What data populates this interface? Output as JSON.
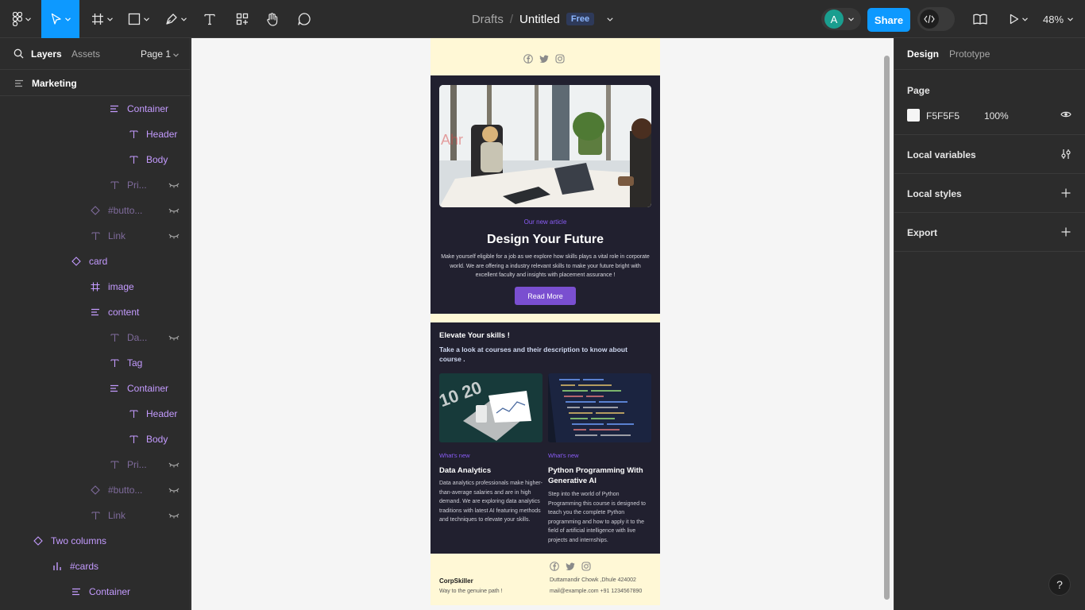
{
  "toolbar": {
    "breadcrumb_folder": "Drafts",
    "breadcrumb_sep": "/",
    "file_title": "Untitled",
    "plan_badge": "Free",
    "avatar_initial": "A",
    "share_label": "Share",
    "zoom": "48%"
  },
  "left_panel": {
    "tab_layers": "Layers",
    "tab_assets": "Assets",
    "page_selector": "Page 1",
    "root_layer": "Marketing",
    "layers": [
      {
        "label": "Container",
        "icon": "autolayout-icon"
      },
      {
        "label": "Header",
        "icon": "text-icon"
      },
      {
        "label": "Body",
        "icon": "text-icon"
      },
      {
        "label": "Pri...",
        "icon": "text-icon"
      },
      {
        "label": "#butto...",
        "icon": "instance-icon"
      },
      {
        "label": "Link",
        "icon": "text-icon"
      },
      {
        "label": "card",
        "icon": "instance-icon"
      },
      {
        "label": "image",
        "icon": "frame-icon"
      },
      {
        "label": "content",
        "icon": "autolayout-icon"
      },
      {
        "label": "Da...",
        "icon": "text-icon"
      },
      {
        "label": "Tag",
        "icon": "text-icon"
      },
      {
        "label": "Container",
        "icon": "autolayout-icon"
      },
      {
        "label": "Header",
        "icon": "text-icon"
      },
      {
        "label": "Body",
        "icon": "text-icon"
      },
      {
        "label": "Pri...",
        "icon": "text-icon"
      },
      {
        "label": "#butto...",
        "icon": "instance-icon"
      },
      {
        "label": "Link",
        "icon": "text-icon"
      },
      {
        "label": "Two columns",
        "icon": "instance-icon"
      },
      {
        "label": "#cards",
        "icon": "bar-chart-icon"
      },
      {
        "label": "Container",
        "icon": "autolayout-icon"
      }
    ]
  },
  "email": {
    "hero": {
      "tag": "Our new article",
      "title": "Design Your Future",
      "body": "Make yourself eligible for a job as we explore how skills plays a vital role in corporate world. We are offering a industry relevant skills to make your future bright with excellent faculty and insights with placement assurance !",
      "button": "Read More"
    },
    "skills": {
      "title": "Elevate Your skills !",
      "subtitle": "Take a look at courses and their description to know about course .",
      "cards": [
        {
          "tag": "What's new",
          "title": "Data Analytics",
          "body": "Data analytics professionals make higher-than-average salaries and are in high demand. We are exploring data analytics traditions with latest AI featuring methods and techniques to elevate your skills."
        },
        {
          "tag": "What's new",
          "title": "Python Programming With Generative AI",
          "body": "Step into the world of Python Programming this course is designed to teach you the complete Python programming and how to apply it to the field of artificial intelligence with live projects and internships."
        }
      ]
    },
    "footer": {
      "brand": "CorpSkiller",
      "tagline": "Way to the genuine path !",
      "address": "Duttamandir Chowk ,Dhule 424002",
      "contact": "mail@example.com +91 1234567890"
    }
  },
  "right_panel": {
    "tab_design": "Design",
    "tab_prototype": "Prototype",
    "page_heading": "Page",
    "page_color": "F5F5F5",
    "page_opacity": "100%",
    "local_variables": "Local variables",
    "local_styles": "Local styles",
    "export": "Export"
  },
  "help_label": "?",
  "colors": {
    "accent": "#0d99ff",
    "layer_purple": "#c49bff",
    "email_dark": "#21202f",
    "email_cream": "#fff8d6",
    "email_button": "#7a4fd0"
  }
}
